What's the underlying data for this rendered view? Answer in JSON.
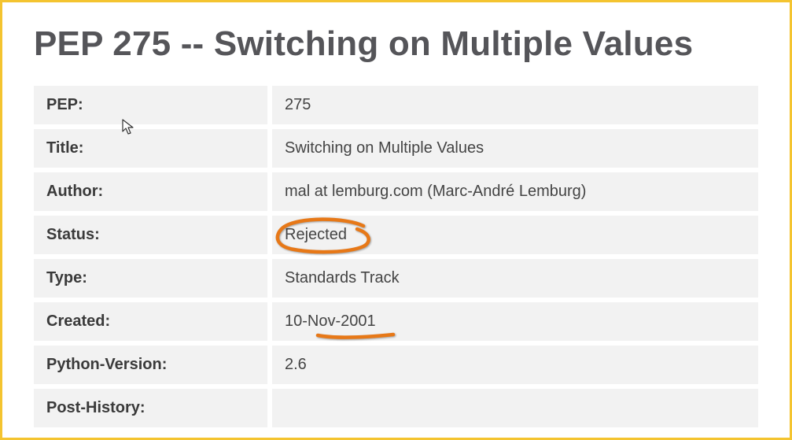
{
  "page": {
    "title": "PEP 275 -- Switching on Multiple Values"
  },
  "meta": {
    "rows": [
      {
        "label": "PEP:",
        "value": "275"
      },
      {
        "label": "Title:",
        "value": "Switching on Multiple Values"
      },
      {
        "label": "Author:",
        "value": "mal at lemburg.com (Marc-André Lemburg)"
      },
      {
        "label": "Status:",
        "value": "Rejected"
      },
      {
        "label": "Type:",
        "value": "Standards Track"
      },
      {
        "label": "Created:",
        "value": "10-Nov-2001"
      },
      {
        "label": "Python-Version:",
        "value": "2.6"
      },
      {
        "label": "Post-History:",
        "value": ""
      }
    ]
  },
  "annotations": {
    "status_circled": true,
    "created_underlined": true,
    "highlight_color": "#e77817"
  }
}
